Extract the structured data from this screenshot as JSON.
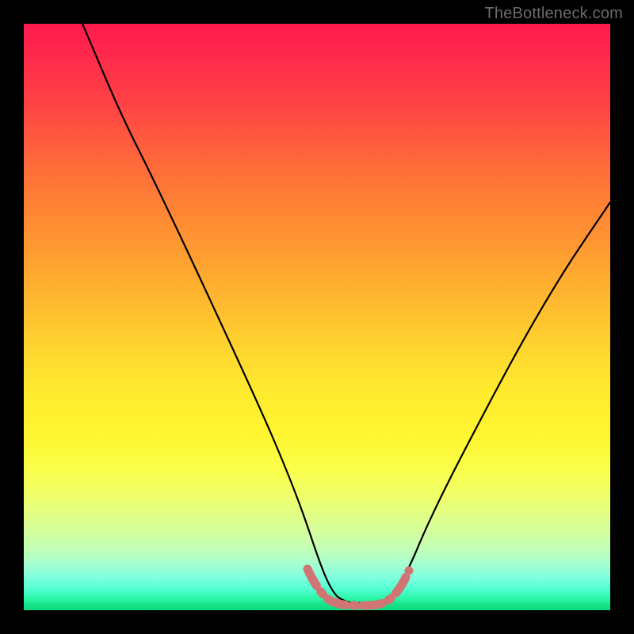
{
  "attribution": "TheBottleneck.com",
  "colors": {
    "frame": "#000000",
    "curve_stroke": "#000000",
    "marker_stroke": "#d07573",
    "gradient_top": "#ff1a4d",
    "gradient_bottom": "#10d97f"
  },
  "chart_data": {
    "type": "line",
    "title": "",
    "xlabel": "",
    "ylabel": "",
    "xlim": [
      0,
      100
    ],
    "ylim": [
      0,
      100
    ],
    "grid": false,
    "legend": false,
    "series": [
      {
        "name": "black-curve",
        "x": [
          10,
          15,
          20,
          25,
          30,
          35,
          40,
          45,
          50,
          52,
          55,
          58,
          60,
          62,
          65,
          70,
          75,
          80,
          85,
          90,
          95,
          100
        ],
        "y": [
          100,
          90,
          78,
          66,
          54,
          42,
          30,
          18,
          8,
          4,
          2,
          2,
          2,
          3,
          6,
          14,
          24,
          34,
          44,
          53,
          61,
          68
        ]
      },
      {
        "name": "pink-marker",
        "x": [
          49,
          51,
          53,
          55,
          57,
          59,
          61,
          63,
          65
        ],
        "y": [
          7,
          4,
          2.2,
          2,
          2,
          2,
          2.2,
          3.2,
          6
        ]
      }
    ],
    "annotations": []
  }
}
